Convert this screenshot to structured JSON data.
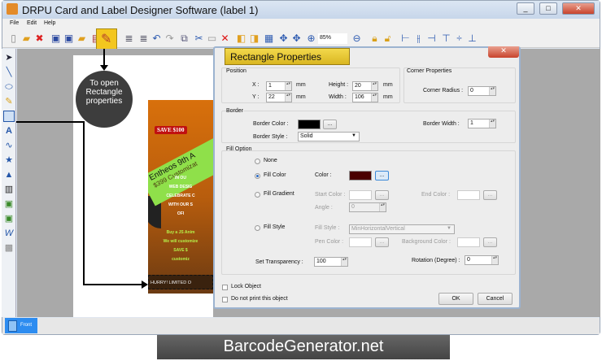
{
  "window": {
    "title": "DRPU Card and Label Designer Software  (label 1)",
    "controls": [
      "_",
      "□",
      "✕"
    ]
  },
  "menu": [
    "File",
    "Edit",
    "Help"
  ],
  "toolbar": {
    "zoom": "85%"
  },
  "callout": {
    "text": "To open Rectangle properties"
  },
  "card": {
    "save": "SAVE $100",
    "ribbon1": "Entheos 9th A",
    "ribbon2": "$399 Customizat",
    "lines": [
      "IN OU",
      "WEB DESIG",
      "CELEBRATE C",
      "WITH OUR S",
      "OFI"
    ],
    "green_lines": [
      "Buy a JS Anim",
      "We will customize",
      "SAVE $",
      "customiz"
    ],
    "footer": "HURRY! LIMITED O"
  },
  "dialog": {
    "title": "Rectangle Properties",
    "position": {
      "label": "Position",
      "x_label": "X :",
      "x": "1",
      "y_label": "Y :",
      "y": "22",
      "height_label": "Height :",
      "height": "20",
      "width_label": "Width :",
      "width": "106",
      "unit": "mm"
    },
    "corner": {
      "label": "Corner Properties",
      "radius_label": "Corner Radius :",
      "radius": "0"
    },
    "border": {
      "label": "Border",
      "color_label": "Border Color :",
      "color": "#000000",
      "style_label": "Border Style :",
      "style": "Solid",
      "width_label": "Border Width :",
      "width": "1",
      "browse": "..."
    },
    "fill": {
      "label": "Fill Option",
      "none": "None",
      "fill_color": "Fill Color",
      "color_label": "Color :",
      "color": "#4a0000",
      "gradient": "Fill Gradient",
      "start_label": "Start Color :",
      "end_label": "End Color :",
      "angle_label": "Angle :",
      "angle": "0",
      "style": "Fill Style",
      "style_label": "Fill Style :",
      "style_value": "MinHorizontalVertical",
      "pen_label": "Pen Color :",
      "bg_label": "Background Color :",
      "transparency_label": "Set Transparency :",
      "transparency": "100",
      "rotation_label": "Rotation (Degree) :",
      "rotation": "0",
      "selected": "Fill Color"
    },
    "lock": "Lock Object",
    "noprint": "Do not print this object",
    "ok": "OK",
    "cancel": "Cancel"
  },
  "tabs": {
    "front": "Front"
  },
  "brand": "BarcodeGenerator.net"
}
